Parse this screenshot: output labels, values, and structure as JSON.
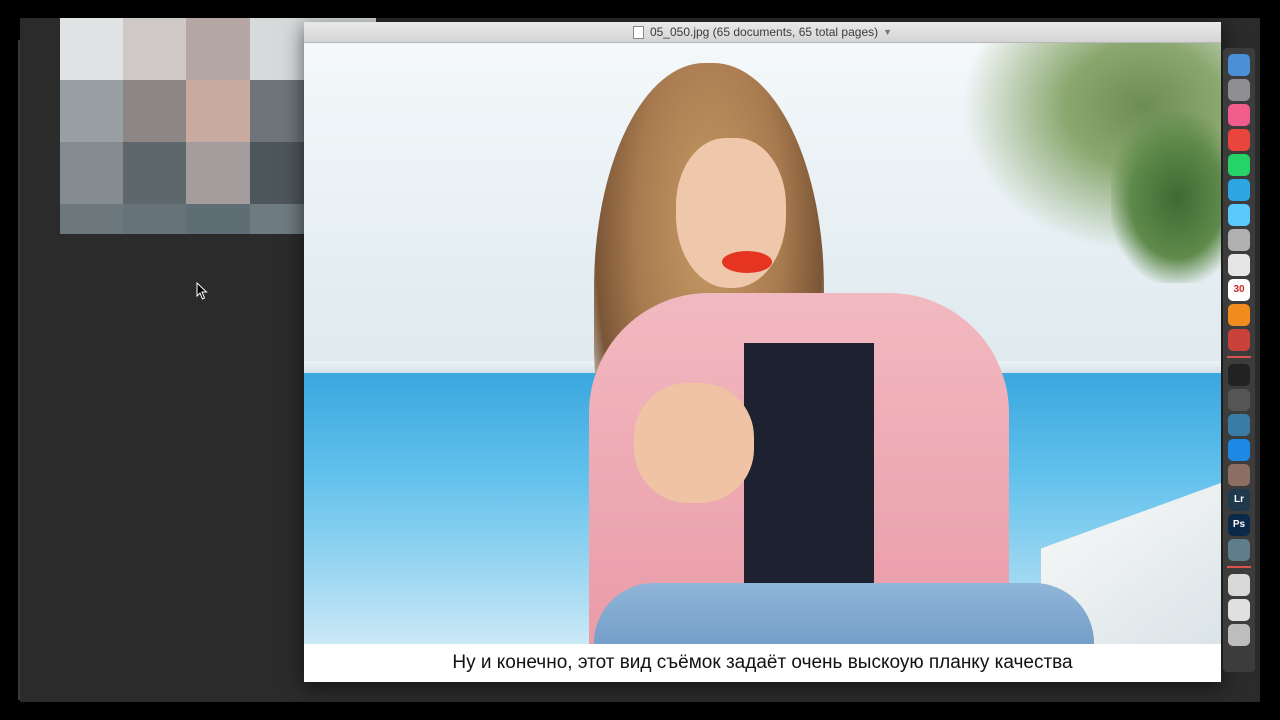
{
  "window": {
    "title": "05_050.jpg (65 documents, 65 total pages)"
  },
  "subtitle": {
    "text": "Ну и конечно, этот вид съёмок задаёт очень выскоую планку качества"
  },
  "pixel_thumbnail": {
    "colors": [
      "#dfe3e4",
      "#cec8c7",
      "#b5a8a4",
      "#d6dadb",
      "#dde1e2",
      "#98a0a4",
      "#8c8684",
      "#c9aaa1",
      "#6e7479",
      "#b2b8bb",
      "#848c91",
      "#5e676c",
      "#a39e9d",
      "#4d565b",
      "#959b9d",
      "#6d787d",
      "#66747a",
      "#5f6e74",
      "#6e7b80",
      "#7f8b8f"
    ]
  },
  "dock": {
    "items": [
      {
        "icon": "finder-icon",
        "label": "",
        "color": "#4a90d9"
      },
      {
        "icon": "system-preferences-icon",
        "label": "",
        "color": "#8e8e93"
      },
      {
        "icon": "itunes-icon",
        "label": "",
        "color": "#f05c8b"
      },
      {
        "icon": "chrome-icon",
        "label": "",
        "color": "#e8453c"
      },
      {
        "icon": "whatsapp-icon",
        "label": "",
        "color": "#25d366"
      },
      {
        "icon": "telegram-icon",
        "label": "",
        "color": "#2ca5e0"
      },
      {
        "icon": "messages-icon",
        "label": "",
        "color": "#5ac8fa"
      },
      {
        "icon": "preview-icon",
        "label": "",
        "color": "#b0b0b0"
      },
      {
        "icon": "textedit-icon",
        "label": "",
        "color": "#e6e6e6"
      },
      {
        "icon": "calendar-icon",
        "label": "30",
        "color": "#ffffff"
      },
      {
        "icon": "vlc-icon",
        "label": "",
        "color": "#f28c1e"
      },
      {
        "icon": "photo-booth-icon",
        "label": "",
        "color": "#c9423a"
      },
      {
        "icon": "obs-icon",
        "label": "",
        "color": "#222222"
      },
      {
        "icon": "camera-icon",
        "label": "",
        "color": "#555555"
      },
      {
        "icon": "screenflow-icon",
        "label": "",
        "color": "#3a7ca5"
      },
      {
        "icon": "migration-icon",
        "label": "",
        "color": "#1e88e5"
      },
      {
        "icon": "photo-app-icon",
        "label": "",
        "color": "#8d6e63"
      },
      {
        "icon": "lightroom-icon",
        "label": "Lr",
        "color": "#1f3a4d"
      },
      {
        "icon": "photoshop-icon",
        "label": "Ps",
        "color": "#0b2a4a"
      },
      {
        "icon": "image-capture-icon",
        "label": "",
        "color": "#607d8b"
      },
      {
        "icon": "downloads-icon",
        "label": "",
        "color": "#d9d9d9"
      },
      {
        "icon": "documents-icon",
        "label": "",
        "color": "#e0e0e0"
      },
      {
        "icon": "trash-icon",
        "label": "",
        "color": "#bdbdbd"
      }
    ]
  }
}
